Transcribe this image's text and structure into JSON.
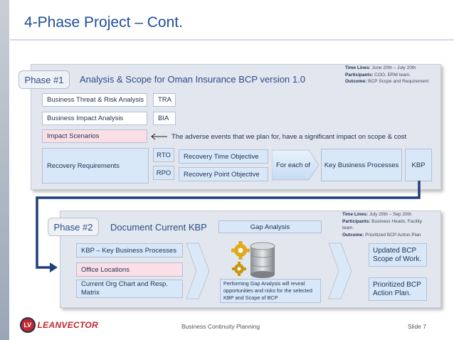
{
  "title": "4-Phase Project – Cont.",
  "phase1": {
    "tag": "Phase #1",
    "heading": "Analysis & Scope for Oman Insurance BCP version 1.0",
    "timeline": {
      "time_lines_label": "Time Lines",
      "time_lines_value": ": June 20th – July 20th",
      "participants_label": "Participants:",
      "participants_value": " COO, ERM team.",
      "outcome_label": "Outcome:",
      "outcome_value": " BCP Scope and Requirement"
    },
    "items": {
      "threat": "Business Threat & Risk Analysis",
      "tra": "TRA",
      "impact": "Business Impact Analysis",
      "bia": "BIA",
      "scenarios": "Impact Scenarios",
      "scenario_note": "The adverse events that we plan for, have a significant impact on scope & cost",
      "recovery": "Recovery Requirements",
      "rto": "RTO",
      "rto_full": "Recovery Time Objective",
      "rpo": "RPO",
      "rpo_full": "Recovery Point Objective",
      "for_each": "For each of",
      "kbp_full": "Key Business Processes",
      "kbp": "KBP"
    }
  },
  "phase2": {
    "tag": "Phase #2",
    "heading": "Document Current KBP",
    "gap_label": "Gap Analysis",
    "timeline": {
      "time_lines_label": "Time Lines:",
      "time_lines_value": " July 20th – Sep 20th",
      "participants_label": "Participants:",
      "participants_value": " Business Heads, Facility",
      "participants_value2": "team.",
      "outcome_label": "Outcome:",
      "outcome_value": " Prioritized BCP Action Plan"
    },
    "items": {
      "kbp": "KBP – Key Business Processes",
      "office": "Office Locations",
      "org": "Current Org Chart and Resp. Matrix",
      "gap_desc": "Performing Gap Analysis will reveal opportunities and risks for the selected KBP and Scope of BCP",
      "updated": "Updated BCP Scope of Work.",
      "prioritized": "Prioritized BCP Action Plan."
    }
  },
  "footer": {
    "logo_initials": "LV",
    "logo_text": "LEANVECTOR",
    "center": "Business Continuity Planning",
    "slide": "Slide 7"
  },
  "colors": {
    "title": "#1f4e9a",
    "logo_red": "#c0262d",
    "connector_blue": "#1f3f7a"
  }
}
